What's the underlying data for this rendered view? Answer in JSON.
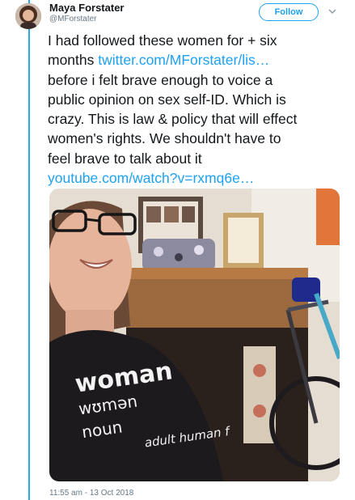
{
  "author": {
    "display_name": "Maya Forstater",
    "handle": "@MForstater"
  },
  "follow_label": "Follow",
  "tweet": {
    "line1": "I had followed these women for + six",
    "line2_text": "months ",
    "link1": "twitter.com/MForstater/lis…",
    "line3": "before i felt brave enough to voice a",
    "line4": "public opinion on sex self-ID. Which is",
    "line5": "crazy. This is law & policy that will effect",
    "line6": "women's rights. We shouldn't have to",
    "line7": "feel brave to talk about it",
    "link2": "youtube.com/watch?v=rxmq6e…"
  },
  "shirt_text": {
    "line1": "woman",
    "line2": "wʊmən",
    "line3": "noun",
    "line4": "adult human f"
  },
  "timestamp": "11:55 am - 13 Oct 2018",
  "colors": {
    "accent": "#1da1f2",
    "thread": "#28a9e0",
    "text": "#14171a",
    "muted": "#657786"
  },
  "icons": {
    "caret": "chevron-down-icon"
  }
}
